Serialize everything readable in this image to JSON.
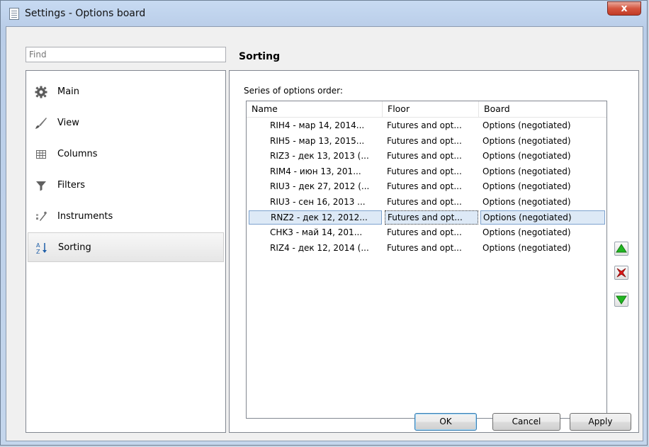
{
  "window": {
    "title": "Settings - Options board",
    "close_glyph": "x"
  },
  "search": {
    "placeholder": "Find"
  },
  "nav": {
    "items": [
      {
        "label": "Main",
        "icon": "gear-icon"
      },
      {
        "label": "View",
        "icon": "brush-icon"
      },
      {
        "label": "Columns",
        "icon": "grid-icon"
      },
      {
        "label": "Filters",
        "icon": "funnel-icon"
      },
      {
        "label": "Instruments",
        "icon": "tools-icon"
      },
      {
        "label": "Sorting",
        "icon": "sort-az-icon"
      }
    ],
    "selected": "Sorting"
  },
  "section": {
    "title": "Sorting",
    "list_label": "Series of options order:"
  },
  "table": {
    "columns": [
      "Name",
      "Floor",
      "Board"
    ],
    "rows": [
      [
        "RIH4 - мар 14, 2014...",
        "Futures and opt...",
        "Options (negotiated)"
      ],
      [
        "RIH5 - мар 13, 2015...",
        "Futures and opt...",
        "Options (negotiated)"
      ],
      [
        "RIZ3 - дек 13, 2013 (...",
        "Futures and opt...",
        "Options (negotiated)"
      ],
      [
        "RIM4 - июн 13, 201...",
        "Futures and opt...",
        "Options (negotiated)"
      ],
      [
        "RIU3 - дек 27, 2012 (...",
        "Futures and opt...",
        "Options (negotiated)"
      ],
      [
        "RIU3 - сен 16, 2013 ...",
        "Futures and opt...",
        "Options (negotiated)"
      ],
      [
        "RNZ2 - дек 12, 2012...",
        "Futures and opt...",
        "Options (negotiated)"
      ],
      [
        "CHK3 - май 14, 201...",
        "Futures and opt...",
        "Options (negotiated)"
      ],
      [
        "RIZ4 - дек 12, 2014 (...",
        "Futures and opt...",
        "Options (negotiated)"
      ]
    ],
    "selected_row_index": 6
  },
  "footer": {
    "ok": "OK",
    "cancel": "Cancel",
    "apply": "Apply"
  },
  "colors": {
    "move_up": "#22b722",
    "remove": "#e01818",
    "move_down": "#22b722"
  }
}
